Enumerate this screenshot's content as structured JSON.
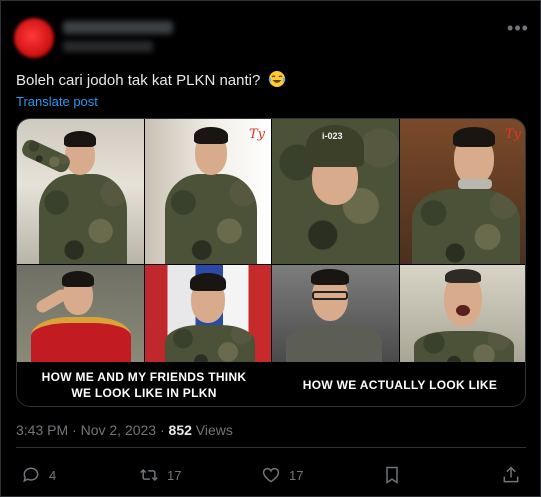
{
  "tweet": {
    "text": "Boleh cari jodoh tak kat PLKN nanti?",
    "emoji": "face-with-tears-of-joy",
    "translate_label": "Translate post",
    "time": "3:43 PM",
    "date": "Nov 2, 2023",
    "separator": "·",
    "views_count": "852",
    "views_label": "Views"
  },
  "media": {
    "caption_left": "HOW ME AND MY FRIENDS THINK WE LOOK LIKE IN PLKN",
    "caption_right": "HOW WE ACTUALLY LOOK LIKE",
    "badge_text": "i-023",
    "signature": "Ty"
  },
  "actions": {
    "reply_count": "4",
    "repost_count": "17",
    "like_count": "17"
  },
  "colors": {
    "background": "#000000",
    "text": "#e7e9ea",
    "muted": "#71767b",
    "link": "#1d9bf0",
    "border": "#2f3336"
  }
}
